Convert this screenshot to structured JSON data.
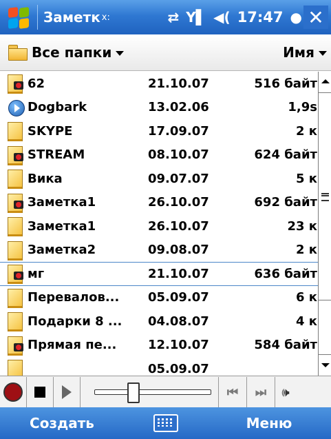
{
  "titlebar": {
    "app_title": "Заметк",
    "app_icon_glyph": "x:",
    "time": "17:47",
    "icons": [
      "sync-icon",
      "signal-icon",
      "speaker-icon"
    ],
    "close_label": "✕"
  },
  "filterbar": {
    "folder_label": "Все папки",
    "sort_label": "Имя"
  },
  "files": [
    {
      "name": "62",
      "date": "21.10.07",
      "size": "516 байт",
      "icon": "voice-note-icon"
    },
    {
      "name": "Dogbark",
      "date": "13.02.06",
      "size": "1,9s",
      "icon": "media-play-icon"
    },
    {
      "name": "SKYPE",
      "date": "17.09.07",
      "size": "2 к",
      "icon": "note-icon"
    },
    {
      "name": "STREAM",
      "date": "08.10.07",
      "size": "624 байт",
      "icon": "voice-note-icon"
    },
    {
      "name": "Вика",
      "date": "09.07.07",
      "size": "5 к",
      "icon": "note-icon"
    },
    {
      "name": "Заметка1",
      "date": "26.10.07",
      "size": "692 байт",
      "icon": "voice-note-icon"
    },
    {
      "name": "Заметка1",
      "date": "26.10.07",
      "size": "23 к",
      "icon": "note-icon"
    },
    {
      "name": "Заметка2",
      "date": "09.08.07",
      "size": "2 к",
      "icon": "note-icon"
    },
    {
      "name": "мг",
      "date": "21.10.07",
      "size": "636 байт",
      "icon": "voice-note-icon",
      "selected": true
    },
    {
      "name": "Перевалов...",
      "date": "05.09.07",
      "size": "6 к",
      "icon": "note-icon"
    },
    {
      "name": "Подарки 8 ...",
      "date": "04.08.07",
      "size": "4 к",
      "icon": "note-icon"
    },
    {
      "name": "Прямая пе...",
      "date": "12.10.07",
      "size": "584 байт",
      "icon": "voice-note-icon"
    },
    {
      "name": "",
      "date": "05.09.07",
      "size": "",
      "icon": "note-icon"
    }
  ],
  "player": {
    "prev_label": "⏮",
    "next_label": "⏭",
    "volume_label": "🕪"
  },
  "softkeys": {
    "left": "Создать",
    "right": "Меню"
  }
}
